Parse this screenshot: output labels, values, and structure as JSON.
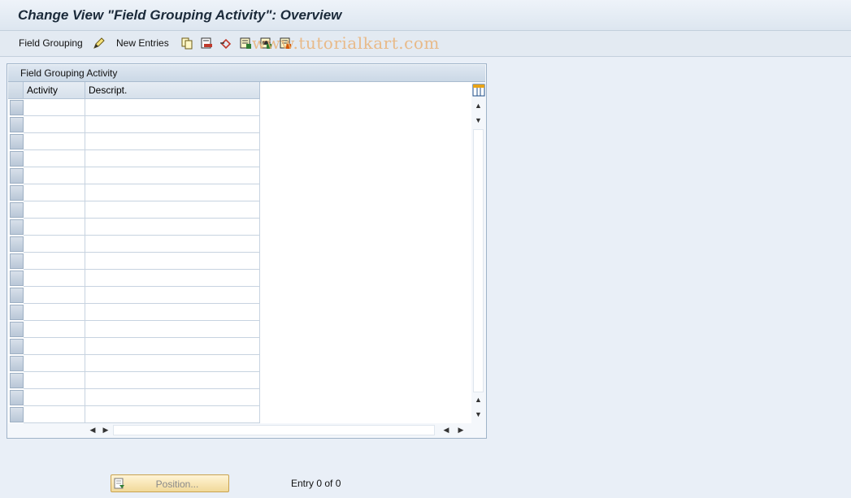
{
  "title": "Change View \"Field Grouping Activity\": Overview",
  "toolbar": {
    "field_grouping_label": "Field Grouping",
    "new_entries_label": "New Entries",
    "watermark": "www.tutorialkart.com",
    "icons": [
      "edit-pencil-icon",
      "copy-icon",
      "delete-icon",
      "undo-icon",
      "select-all-icon",
      "select-block-icon",
      "deselect-all-icon"
    ]
  },
  "panel": {
    "title": "Field Grouping Activity",
    "columns": [
      "Activity",
      "Descript."
    ],
    "rows": 19
  },
  "position_button": {
    "label": "Position..."
  },
  "entry_count": "Entry 0 of 0",
  "colors": {
    "background": "#e9eff7",
    "button": "#f1d999",
    "header": "#cbd8e6"
  }
}
